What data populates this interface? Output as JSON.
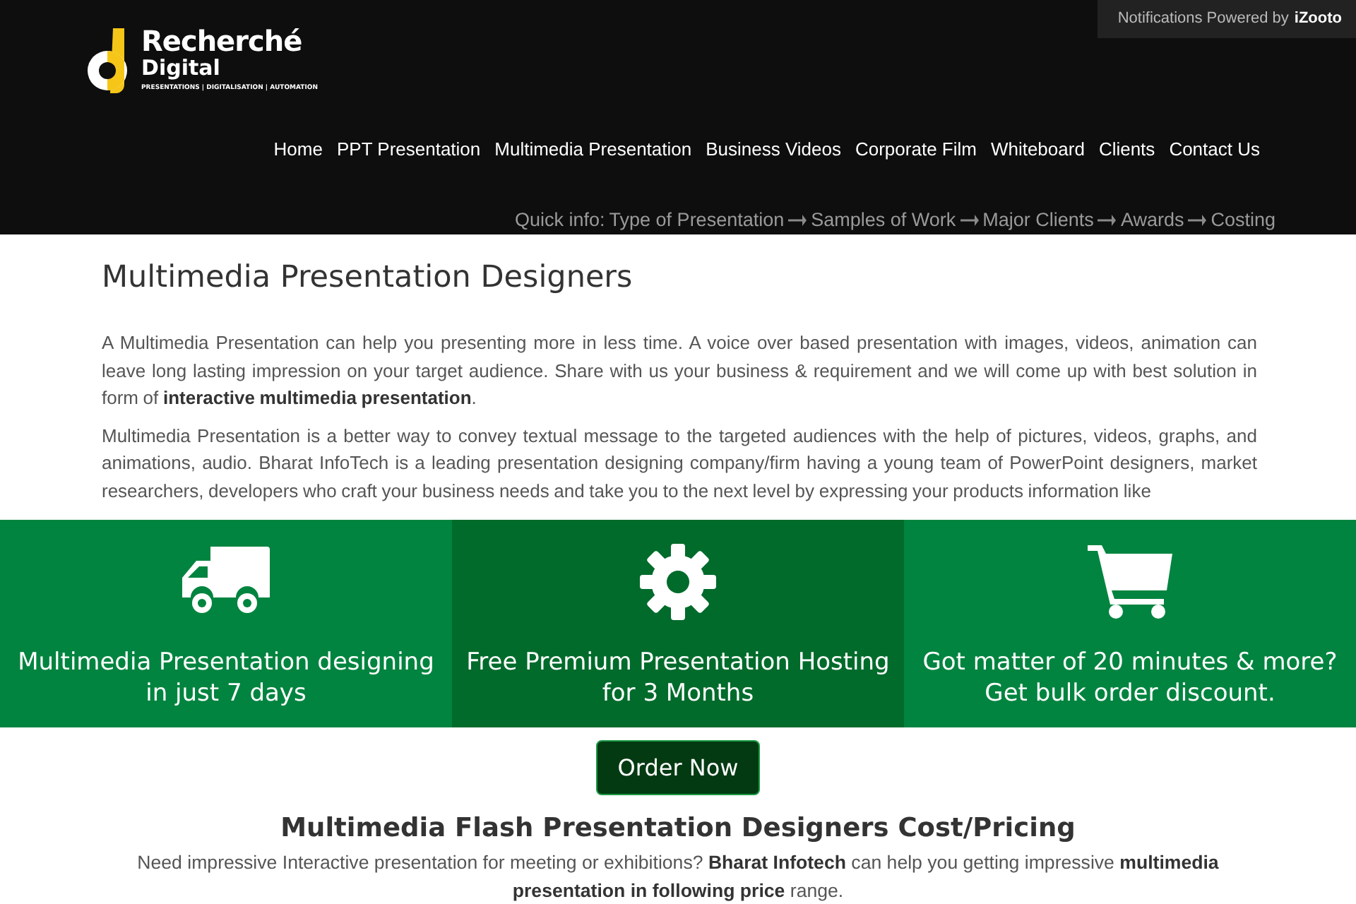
{
  "notification": {
    "text": "Notifications Powered by",
    "brand": "iZooto"
  },
  "logo": {
    "name": "Recherché",
    "sub": "Digital",
    "tagline": "PRESENTATIONS | DIGITALISATION | AUTOMATION"
  },
  "nav": [
    "Home",
    "PPT Presentation",
    "Multimedia Presentation",
    "Business Videos",
    "Corporate Film",
    "Whiteboard",
    "Clients",
    "Contact Us"
  ],
  "quick_info": {
    "label": "Quick info:",
    "items": [
      "Type of Presentation",
      "Samples of Work",
      "Major Clients",
      "Awards",
      "Costing"
    ]
  },
  "title": "Multimedia Presentation Designers",
  "paragraphs": [
    "A Multimedia Presentation can help you presenting more in less time.  A voice over based presentation with images, videos, animation can leave long lasting impression on your target audience. Share with us your business & requirement and we will come up with best solution in form of **interactive multimedia presentation**.",
    "Multimedia Presentation is a better way to convey textual message to the targeted audiences with the help of pictures, videos, graphs, and animations, audio. Bharat InfoTech is a leading presentation designing company/firm having a young team of PowerPoint designers, market researchers, developers who craft your business needs and take you to the next level by expressing your products information like"
  ],
  "features": [
    {
      "kind": "truck",
      "text": "Multimedia Presentation designing in just 7 days",
      "highlighted": false
    },
    {
      "kind": "gear",
      "text": "Free Premium Presentation Hosting for 3 Months",
      "highlighted": true
    },
    {
      "kind": "cart",
      "text": "Got matter of 20 minutes & more? Get bulk order discount.",
      "highlighted": false
    }
  ],
  "order_button": "Order Now",
  "pricing": {
    "heading": "Multimedia Flash Presentation Designers Cost/Pricing",
    "text": "Need impressive Interactive presentation for meeting or exhibitions? **Bharat Infotech** can help you getting impressive **multimedia presentation in following price** range."
  }
}
